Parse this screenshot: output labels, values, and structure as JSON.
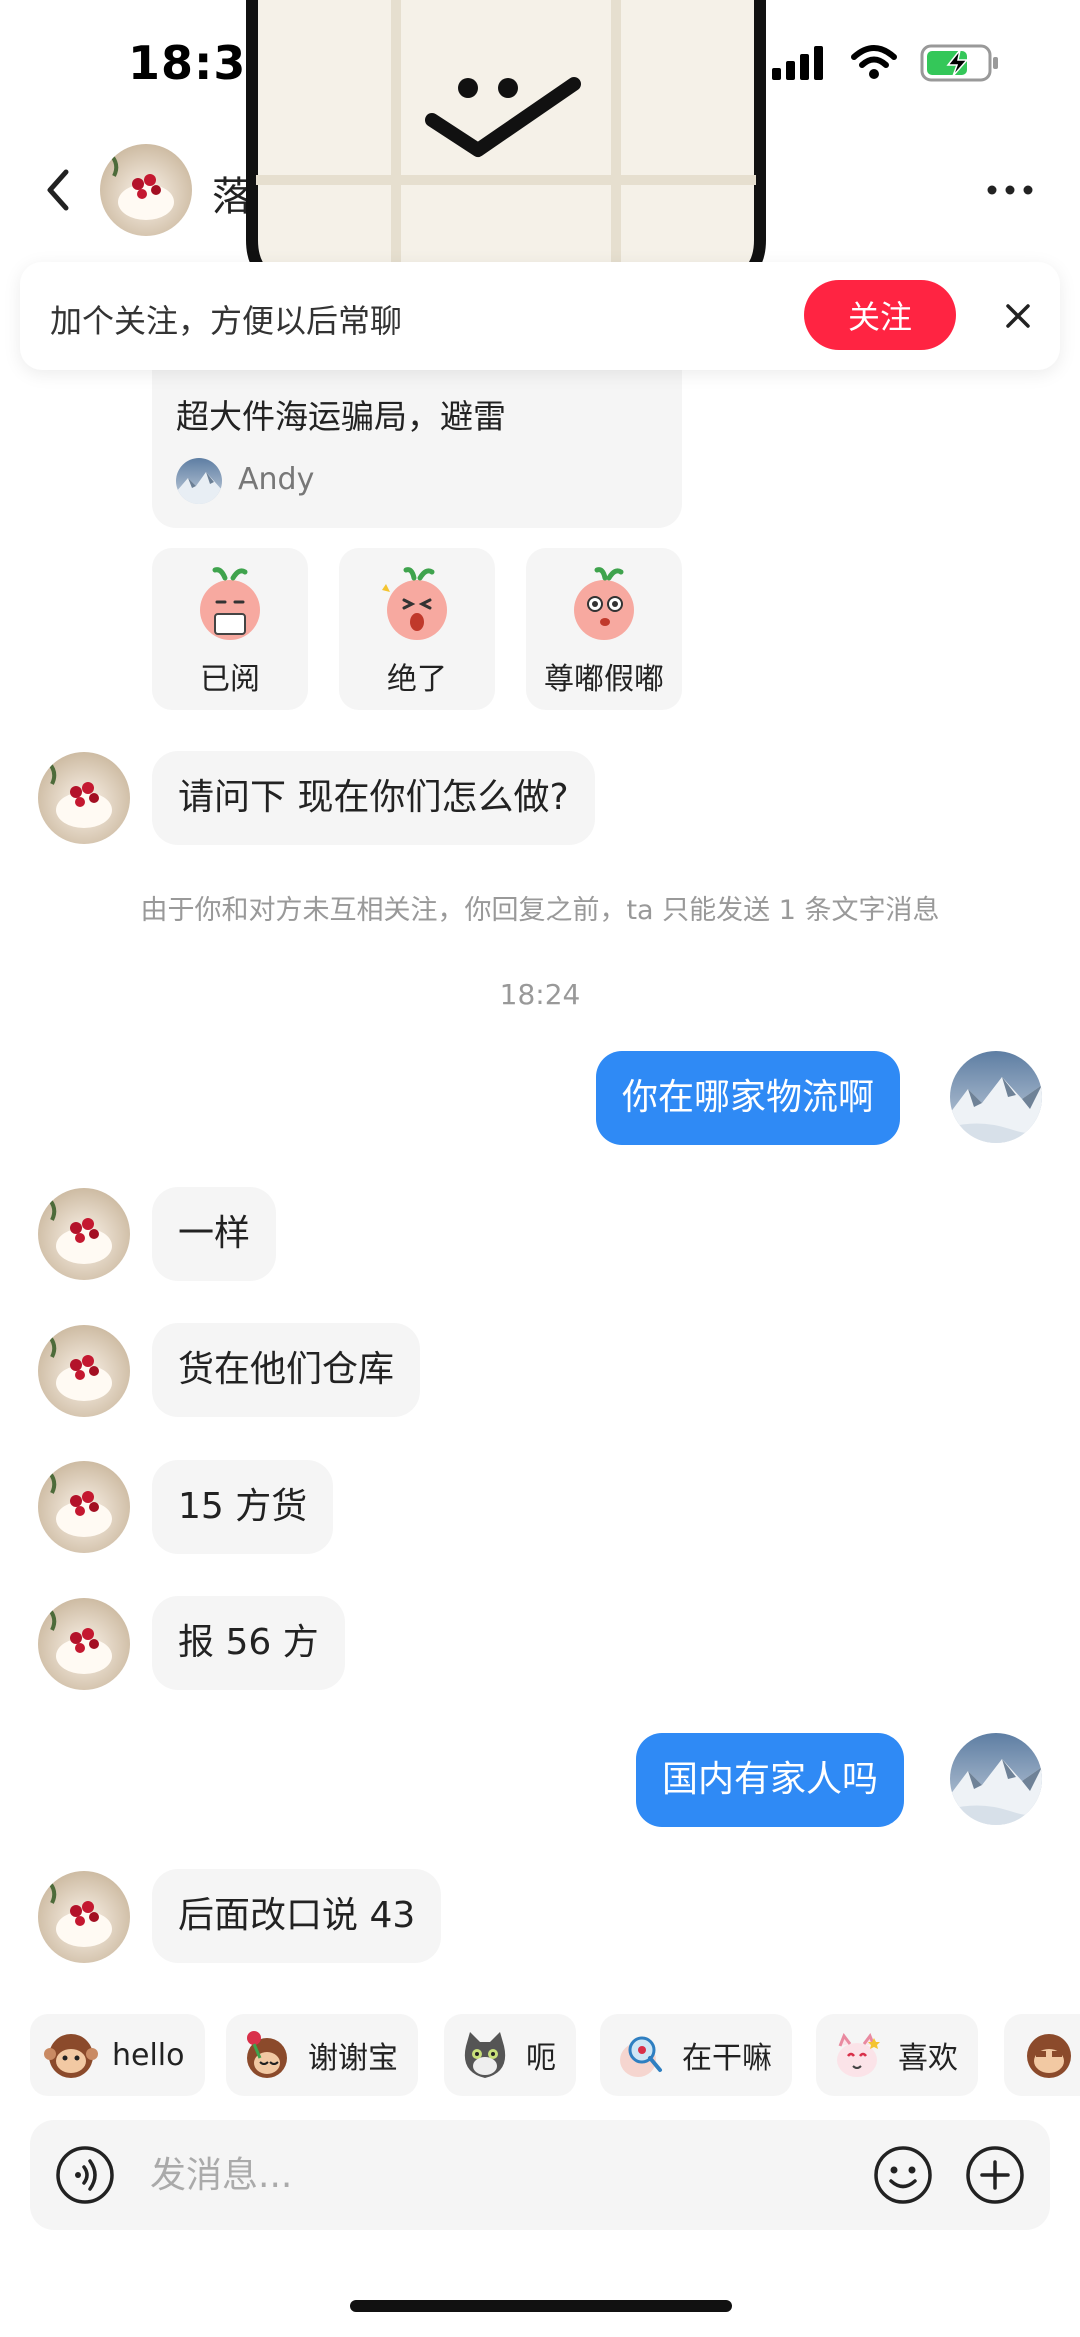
{
  "status_bar": {
    "time": "18:33",
    "icons": [
      "signal-icon",
      "wifi-icon",
      "battery-charging-icon"
    ]
  },
  "header": {
    "name": "落",
    "back_icon": "chevron-left-icon",
    "more_icon": "more-dots-icon"
  },
  "follow_banner": {
    "text": "加个关注，方便以后常聊",
    "button": "关注",
    "close_icon": "close-icon"
  },
  "shared_card": {
    "title": "超大件海运骗局，避雷",
    "author": "Andy"
  },
  "quick_replies": [
    {
      "label": "已阅",
      "icon": "peach-reading-sticker-icon"
    },
    {
      "label": "绝了",
      "icon": "peach-amazed-sticker-icon"
    },
    {
      "label": "尊嘟假嘟",
      "icon": "peach-really-sticker-icon"
    }
  ],
  "messages": {
    "m1": "请问下 现在你们怎么做?",
    "system_note": "由于你和对方未互相关注，你回复之前，ta 只能发送 1 条文字消息",
    "timestamp": "18:24",
    "m2": "你在哪家物流啊",
    "m3": "一样",
    "m4": "货在他们仓库",
    "m5": "15 方货",
    "m6": "报 56 方",
    "m7": "国内有家人吗",
    "m8": "后面改口说 43"
  },
  "sticker_suggestions": [
    {
      "label": "hello",
      "icon": "monkey-sticker-icon"
    },
    {
      "label": "谢谢宝",
      "icon": "monkey-rose-sticker-icon"
    },
    {
      "label": "呃",
      "icon": "cat-sticker-icon"
    },
    {
      "label": "在干嘛",
      "icon": "magnifier-sticker-icon"
    },
    {
      "label": "喜欢",
      "icon": "cat-love-sticker-icon"
    }
  ],
  "composer": {
    "placeholder": "发消息...",
    "voice_icon": "voice-icon",
    "emoji_icon": "emoji-icon",
    "plus_icon": "plus-icon"
  },
  "colors": {
    "accent_red": "#ff2442",
    "outgoing_bubble": "#2f8af5",
    "incoming_bubble": "#f5f5f5"
  }
}
